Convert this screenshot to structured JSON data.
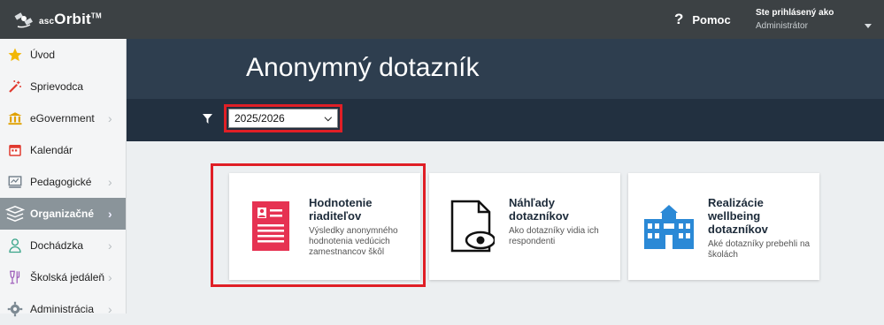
{
  "app": {
    "logo_small": "asc",
    "logo_main": "Orbit",
    "logo_tm": "TM"
  },
  "topbar": {
    "help_icon": "?",
    "help_label": "Pomoc",
    "user_line1": "Ste prihlásený ako",
    "user_line2": "Administrátor"
  },
  "sidebar": {
    "items": [
      {
        "label": "Úvod",
        "icon": "star-icon",
        "color": "#f2b705"
      },
      {
        "label": "Sprievodca",
        "icon": "magic-wand-icon",
        "color": "#e03a2f"
      },
      {
        "label": "eGovernment",
        "icon": "bank-icon",
        "color": "#e0a100"
      },
      {
        "label": "Kalendár",
        "icon": "calendar-icon",
        "color": "#e03a2f"
      },
      {
        "label": "Pedagogické",
        "icon": "whiteboard-icon",
        "color": "#6c7a85"
      },
      {
        "label": "Organizačné",
        "icon": "layers-icon",
        "color": "#ffffff"
      },
      {
        "label": "Dochádzka",
        "icon": "person-icon",
        "color": "#3aa58a"
      },
      {
        "label": "Školská jedáleň",
        "icon": "glass-icon",
        "color": "#9a57b8"
      },
      {
        "label": "Administrácia",
        "icon": "gear-icon",
        "color": "#7d8a93"
      }
    ]
  },
  "page": {
    "title": "Anonymný dotazník"
  },
  "filter": {
    "selected": "2025/2026"
  },
  "cards": [
    {
      "title": "Hodnotenie riaditeľov",
      "desc": "Výsledky anonymného hodnotenia vedúcich zamestnancov škôl",
      "icon": "document-list-icon"
    },
    {
      "title": "Náhľady dotazníkov",
      "desc": "Ako dotazníky vidia ich respondenti",
      "icon": "document-eye-icon"
    },
    {
      "title": "Realizácie wellbeing dotazníkov",
      "desc": "Aké dotazníky prebehli na školách",
      "icon": "school-building-icon"
    }
  ],
  "colors": {
    "accent_red": "#e01f26",
    "banner": "#2e3e4f",
    "topbar": "#3c4144",
    "card_red": "#e63252",
    "school_blue": "#2b89d6"
  }
}
